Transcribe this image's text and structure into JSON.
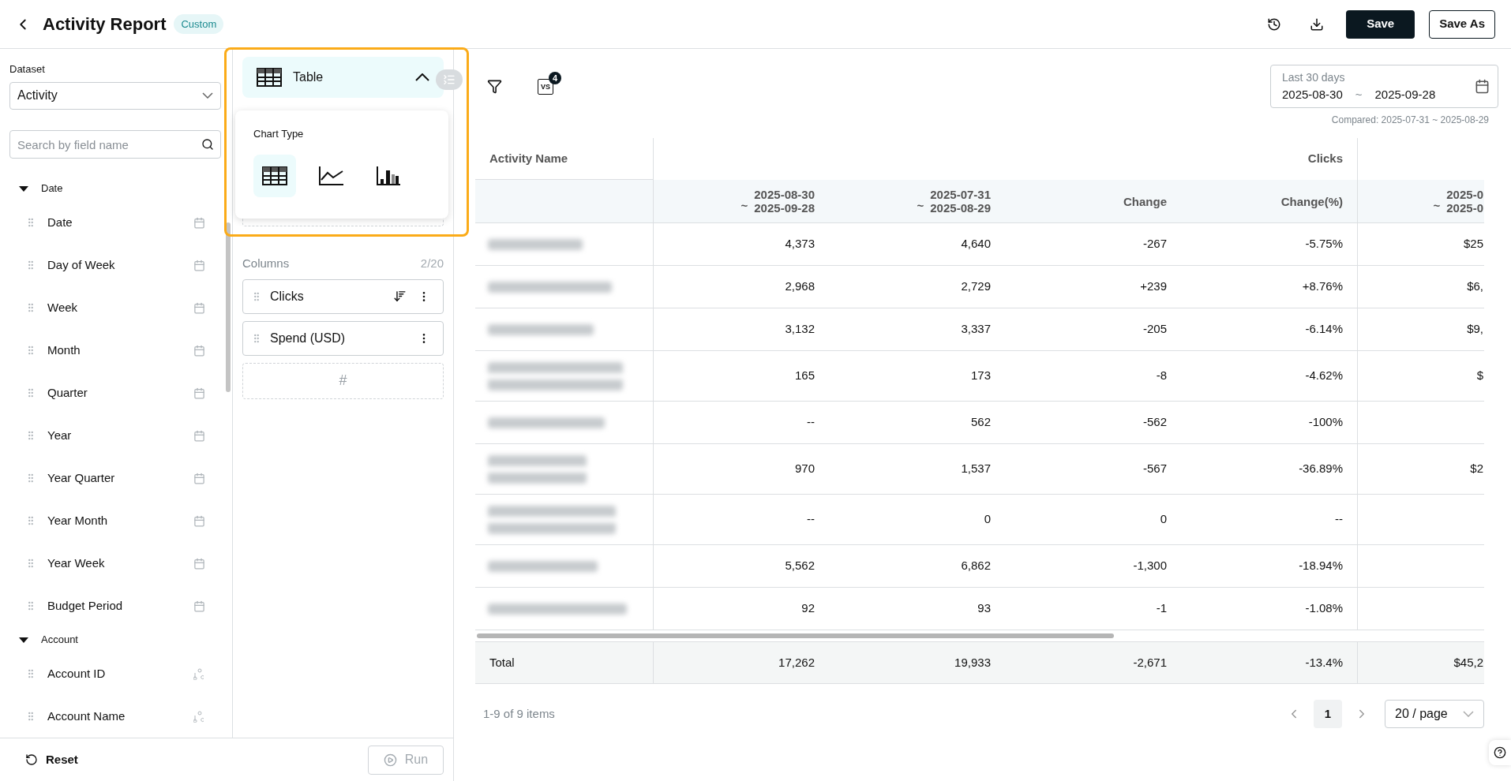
{
  "header": {
    "title": "Activity Report",
    "badge": "Custom",
    "buttons": [
      {
        "label": "Save",
        "kind": "primary"
      },
      {
        "label": "Save As",
        "kind": "secondary"
      }
    ]
  },
  "sidebar": {
    "dataset_label": "Dataset",
    "dataset_value": "Activity",
    "search_placeholder": "Search by field name",
    "groups": [
      {
        "label": "Date",
        "expanded": true,
        "children": [
          {
            "label": "Date",
            "kind": "date"
          },
          {
            "label": "Day of Week",
            "kind": "date"
          },
          {
            "label": "Week",
            "kind": "date"
          },
          {
            "label": "Month",
            "kind": "date"
          },
          {
            "label": "Quarter",
            "kind": "date"
          },
          {
            "label": "Year",
            "kind": "date"
          },
          {
            "label": "Year Quarter",
            "kind": "date"
          },
          {
            "label": "Year Month",
            "kind": "date"
          },
          {
            "label": "Year Week",
            "kind": "date"
          },
          {
            "label": "Budget Period",
            "kind": "date"
          }
        ]
      },
      {
        "label": "Account",
        "expanded": true,
        "children": [
          {
            "label": "Account ID",
            "kind": "text"
          },
          {
            "label": "Account Name",
            "kind": "text"
          }
        ]
      }
    ],
    "reset": "Reset",
    "run": {
      "label": "Run",
      "disabled": true
    }
  },
  "config": {
    "chart_type": {
      "label": "Table",
      "expanded": true,
      "popover_title": "Chart Type",
      "options": [
        {
          "kind": "table",
          "selected": true
        },
        {
          "kind": "line",
          "selected": false
        },
        {
          "kind": "bar",
          "selected": false
        }
      ]
    },
    "columns_label": "Columns",
    "columns_count": "2/20",
    "columns": [
      {
        "label": "Clicks",
        "sortable": true
      },
      {
        "label": "Spend (USD)",
        "sortable": false
      }
    ],
    "drop_hint": "#"
  },
  "toolbar": {
    "compare_icon_text": "VS",
    "compare_count": "4"
  },
  "date_range": {
    "preset": "Last 30 days",
    "start": "2025-08-30",
    "separator": "~",
    "end": "2025-09-28",
    "compared": "Compared: 2025-07-31 ~ 2025-08-29"
  },
  "table": {
    "first_column": "Activity Name",
    "group": "Clicks",
    "subcolumns": [
      {
        "kind": "range",
        "prefix": "~",
        "start": "2025-08-30",
        "end": "2025-09-28"
      },
      {
        "kind": "range",
        "prefix": "~",
        "start": "2025-07-31",
        "end": "2025-08-29"
      },
      {
        "kind": "label",
        "label": "Change"
      },
      {
        "kind": "label",
        "label": "Change(%)"
      },
      {
        "kind": "range",
        "prefix": "~",
        "start": "2025-0",
        "end": "2025-0"
      }
    ],
    "rows": [
      {
        "name_blurred": true,
        "wrapped": false,
        "cells": [
          "4,373",
          "4,640",
          "-267",
          "-5.75%",
          "$25"
        ]
      },
      {
        "name_blurred": true,
        "wrapped": false,
        "cells": [
          "2,968",
          "2,729",
          "+239",
          "+8.76%",
          "$6,"
        ]
      },
      {
        "name_blurred": true,
        "wrapped": false,
        "cells": [
          "3,132",
          "3,337",
          "-205",
          "-6.14%",
          "$9,"
        ]
      },
      {
        "name_blurred": true,
        "wrapped": true,
        "cells": [
          "165",
          "173",
          "-8",
          "-4.62%",
          "$"
        ]
      },
      {
        "name_blurred": true,
        "wrapped": false,
        "cells": [
          "--",
          "562",
          "-562",
          "-100%",
          ""
        ]
      },
      {
        "name_blurred": true,
        "wrapped": true,
        "cells": [
          "970",
          "1,537",
          "-567",
          "-36.89%",
          "$2"
        ]
      },
      {
        "name_blurred": true,
        "wrapped": true,
        "cells": [
          "--",
          "0",
          "0",
          "--",
          ""
        ]
      },
      {
        "name_blurred": true,
        "wrapped": false,
        "cells": [
          "5,562",
          "6,862",
          "-1,300",
          "-18.94%",
          ""
        ]
      },
      {
        "name_blurred": true,
        "wrapped": false,
        "cells": [
          "92",
          "93",
          "-1",
          "-1.08%",
          ""
        ]
      }
    ],
    "total": {
      "label": "Total",
      "cells": [
        "17,262",
        "19,933",
        "-2,671",
        "-13.4%",
        "$45,2"
      ]
    }
  },
  "pagination": {
    "summary": "1-9 of 9 items",
    "pages": [
      {
        "label": "1",
        "selected": true
      }
    ],
    "page_size": "20 / page"
  }
}
